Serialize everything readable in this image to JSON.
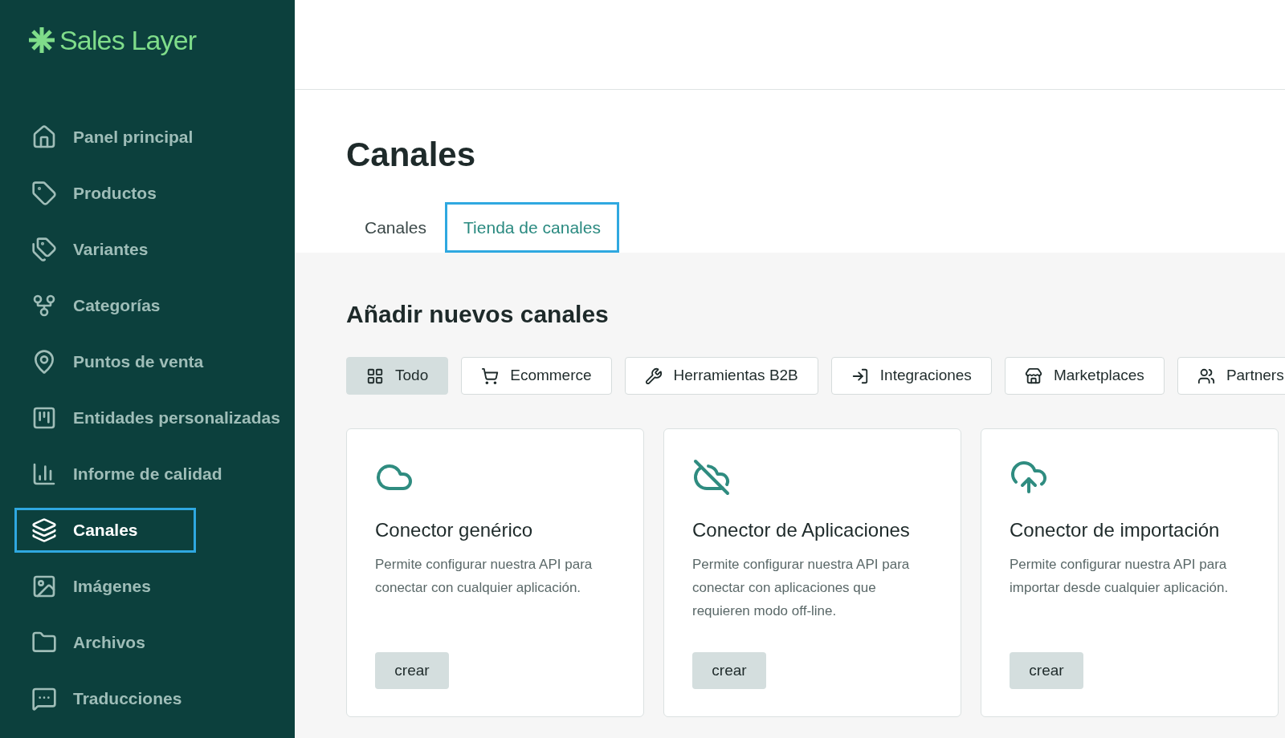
{
  "logo": {
    "text": "Sales Layer"
  },
  "sidebar": {
    "items": [
      {
        "label": "Panel principal",
        "selected": false
      },
      {
        "label": "Productos",
        "selected": false
      },
      {
        "label": "Variantes",
        "selected": false
      },
      {
        "label": "Categorías",
        "selected": false
      },
      {
        "label": "Puntos de venta",
        "selected": false
      },
      {
        "label": "Entidades personalizadas",
        "selected": false
      },
      {
        "label": "Informe de calidad",
        "selected": false
      },
      {
        "label": "Canales",
        "selected": true
      },
      {
        "label": "Imágenes",
        "selected": false
      },
      {
        "label": "Archivos",
        "selected": false
      },
      {
        "label": "Traducciones",
        "selected": false
      }
    ]
  },
  "page": {
    "title": "Canales"
  },
  "tabs": [
    {
      "label": "Canales",
      "selected": false
    },
    {
      "label": "Tienda de canales",
      "selected": true
    }
  ],
  "section": {
    "title": "Añadir nuevos canales"
  },
  "filters": [
    {
      "label": "Todo",
      "selected": true
    },
    {
      "label": "Ecommerce",
      "selected": false
    },
    {
      "label": "Herramientas B2B",
      "selected": false
    },
    {
      "label": "Integraciones",
      "selected": false
    },
    {
      "label": "Marketplaces",
      "selected": false
    },
    {
      "label": "Partners",
      "selected": false
    }
  ],
  "cards": [
    {
      "title": "Conector genérico",
      "description": "Permite configurar nuestra API para conectar con cualquier aplicación.",
      "button": "crear"
    },
    {
      "title": "Conector de Aplicaciones",
      "description": "Permite configurar nuestra API para conectar con aplicaciones que requieren modo off-line.",
      "button": "crear"
    },
    {
      "title": "Conector de importación",
      "description": "Permite configurar nuestra API para importar desde cualquier aplicación.",
      "button": "crear"
    }
  ]
}
